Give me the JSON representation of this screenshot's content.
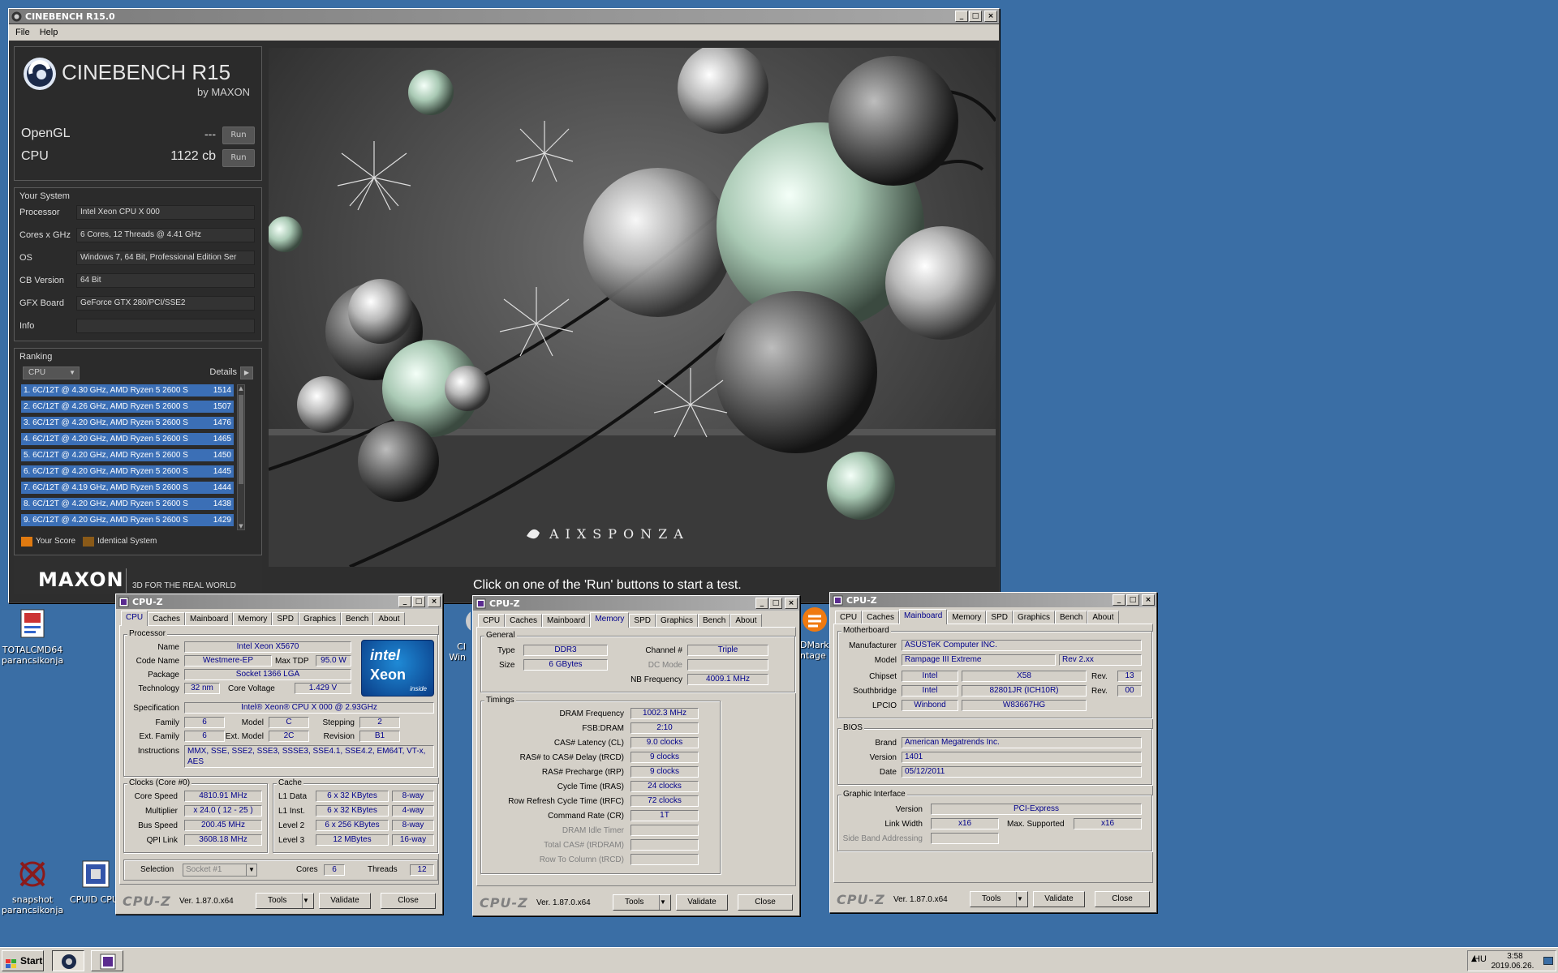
{
  "desktop": {
    "icons": [
      {
        "label": "TOTALCMD64\nparancsikonja"
      },
      {
        "label": "snapshot\nparancsikonja"
      },
      {
        "label": "CPUID CPU-"
      },
      {
        "label": "CI\nWin"
      },
      {
        "label": "DMark\nntage"
      }
    ]
  },
  "cinebench": {
    "title": "CINEBENCH R15.0",
    "menu": [
      "File",
      "Help"
    ],
    "logo_main": "CINEBENCH R15",
    "logo_sub": "by MAXON",
    "tests": [
      {
        "name": "OpenGL",
        "score": "---",
        "button": "Run"
      },
      {
        "name": "CPU",
        "score": "1122 cb",
        "button": "Run"
      }
    ],
    "your_system_title": "Your System",
    "system": [
      {
        "label": "Processor",
        "value": "Intel Xeon CPU X 000"
      },
      {
        "label": "Cores x GHz",
        "value": "6 Cores, 12 Threads @ 4.41 GHz"
      },
      {
        "label": "OS",
        "value": "Windows 7, 64 Bit, Professional Edition Ser"
      },
      {
        "label": "CB Version",
        "value": "64 Bit"
      },
      {
        "label": "GFX Board",
        "value": "GeForce GTX 280/PCI/SSE2"
      },
      {
        "label": "Info",
        "value": ""
      }
    ],
    "ranking_title": "Ranking",
    "ranking_select": "CPU",
    "details_label": "Details",
    "ranking": [
      {
        "text": "1. 6C/12T @ 4.30 GHz, AMD Ryzen 5 2600 S",
        "score": "1514"
      },
      {
        "text": "2. 6C/12T @ 4.26 GHz, AMD Ryzen 5 2600 S",
        "score": "1507"
      },
      {
        "text": "3. 6C/12T @ 4.20 GHz, AMD Ryzen 5 2600 S",
        "score": "1476"
      },
      {
        "text": "4. 6C/12T @ 4.20 GHz, AMD Ryzen 5 2600 S",
        "score": "1465"
      },
      {
        "text": "5. 6C/12T @ 4.20 GHz, AMD Ryzen 5 2600 S",
        "score": "1450"
      },
      {
        "text": "6. 6C/12T @ 4.20 GHz, AMD Ryzen 5 2600 S",
        "score": "1445"
      },
      {
        "text": "7. 6C/12T @ 4.19 GHz, AMD Ryzen 5 2600 S",
        "score": "1444"
      },
      {
        "text": "8. 6C/12T @ 4.20 GHz, AMD Ryzen 5 2600 S",
        "score": "1438"
      },
      {
        "text": "9. 6C/12T @ 4.20 GHz, AMD Ryzen 5 2600 S",
        "score": "1429"
      }
    ],
    "legend_your": "Your Score",
    "legend_identical": "Identical System",
    "maxon": "MAXON",
    "tagline": "3D FOR THE REAL WORLD",
    "render_credit": "AIXSPONZA",
    "status": "Click on one of the 'Run' buttons to start a test."
  },
  "cpuz_cpu": {
    "title": "CPU-Z",
    "tabs": [
      "CPU",
      "Caches",
      "Mainboard",
      "Memory",
      "SPD",
      "Graphics",
      "Bench",
      "About"
    ],
    "processor_group": "Processor",
    "name_label": "Name",
    "name": "Intel Xeon X5670",
    "codename_label": "Code Name",
    "codename": "Westmere-EP",
    "tdp_label": "Max TDP",
    "tdp": "95.0 W",
    "package_label": "Package",
    "package": "Socket 1366 LGA",
    "tech_label": "Technology",
    "tech": "32 nm",
    "voltage_label": "Core Voltage",
    "voltage": "1.429 V",
    "badge_brand": "intel",
    "badge_name": "Xeon",
    "badge_inside": "inside",
    "spec_label": "Specification",
    "spec": "Intel® Xeon® CPU      X 000  @ 2.93GHz",
    "family_label": "Family",
    "family": "6",
    "model_label": "Model",
    "model": "C",
    "stepping_label": "Stepping",
    "stepping": "2",
    "extfamily_label": "Ext. Family",
    "extfamily": "6",
    "extmodel_label": "Ext. Model",
    "extmodel": "2C",
    "revision_label": "Revision",
    "revision": "B1",
    "instr_label": "Instructions",
    "instructions": "MMX, SSE, SSE2, SSE3, SSSE3, SSE4.1, SSE4.2, EM64T, VT-x, AES",
    "clocks_group": "Clocks (Core #0)",
    "corespeed_label": "Core Speed",
    "corespeed": "4810.91 MHz",
    "mult_label": "Multiplier",
    "mult": "x 24.0 ( 12 - 25 )",
    "bus_label": "Bus Speed",
    "bus": "200.45 MHz",
    "qpi_label": "QPI Link",
    "qpi": "3608.18 MHz",
    "cache_group": "Cache",
    "l1d_label": "L1 Data",
    "l1d": "6 x 32 KBytes",
    "l1d_way": "8-way",
    "l1i_label": "L1 Inst.",
    "l1i": "6 x 32 KBytes",
    "l1i_way": "4-way",
    "l2_label": "Level 2",
    "l2": "6 x 256 KBytes",
    "l2_way": "8-way",
    "l3_label": "Level 3",
    "l3": "12 MBytes",
    "l3_way": "16-way",
    "selection_label": "Selection",
    "selection": "Socket #1",
    "cores_label": "Cores",
    "cores": "6",
    "threads_label": "Threads",
    "threads": "12",
    "logo": "CPU-Z",
    "version": "Ver. 1.87.0.x64",
    "tools": "Tools",
    "validate": "Validate",
    "close": "Close"
  },
  "cpuz_mem": {
    "title": "CPU-Z",
    "tabs": [
      "CPU",
      "Caches",
      "Mainboard",
      "Memory",
      "SPD",
      "Graphics",
      "Bench",
      "About"
    ],
    "general_group": "General",
    "type_label": "Type",
    "type": "DDR3",
    "size_label": "Size",
    "size": "6 GBytes",
    "channel_label": "Channel #",
    "channel": "Triple",
    "dcmode_label": "DC Mode",
    "dcmode": "",
    "nbfreq_label": "NB Frequency",
    "nbfreq": "4009.1 MHz",
    "timings_group": "Timings",
    "timings": [
      {
        "label": "DRAM Frequency",
        "value": "1002.3 MHz",
        "dim": false
      },
      {
        "label": "FSB:DRAM",
        "value": "2:10",
        "dim": false
      },
      {
        "label": "CAS# Latency (CL)",
        "value": "9.0 clocks",
        "dim": false
      },
      {
        "label": "RAS# to CAS# Delay (tRCD)",
        "value": "9 clocks",
        "dim": false
      },
      {
        "label": "RAS# Precharge (tRP)",
        "value": "9 clocks",
        "dim": false
      },
      {
        "label": "Cycle Time (tRAS)",
        "value": "24 clocks",
        "dim": false
      },
      {
        "label": "Row Refresh Cycle Time (tRFC)",
        "value": "72 clocks",
        "dim": false
      },
      {
        "label": "Command Rate (CR)",
        "value": "1T",
        "dim": false
      },
      {
        "label": "DRAM Idle Timer",
        "value": "",
        "dim": true
      },
      {
        "label": "Total CAS# (tRDRAM)",
        "value": "",
        "dim": true
      },
      {
        "label": "Row To Column (tRCD)",
        "value": "",
        "dim": true
      }
    ],
    "logo": "CPU-Z",
    "version": "Ver. 1.87.0.x64",
    "tools": "Tools",
    "validate": "Validate",
    "close": "Close"
  },
  "cpuz_mb": {
    "title": "CPU-Z",
    "tabs": [
      "CPU",
      "Caches",
      "Mainboard",
      "Memory",
      "SPD",
      "Graphics",
      "Bench",
      "About"
    ],
    "mb_group": "Motherboard",
    "manufacturer_label": "Manufacturer",
    "manufacturer": "ASUSTeK Computer INC.",
    "model_label": "Model",
    "model": "Rampage III Extreme",
    "model_rev": "Rev 2.xx",
    "chipset_label": "Chipset",
    "chipset_vendor": "Intel",
    "chipset": "X58",
    "chipset_rev_label": "Rev.",
    "chipset_rev": "13",
    "south_label": "Southbridge",
    "south_vendor": "Intel",
    "south": "82801JR (ICH10R)",
    "south_rev_label": "Rev.",
    "south_rev": "00",
    "lpcio_label": "LPCIO",
    "lpcio_vendor": "Winbond",
    "lpcio": "W83667HG",
    "bios_group": "BIOS",
    "brand_label": "Brand",
    "brand": "American Megatrends Inc.",
    "version_label": "Version",
    "bios_version": "1401",
    "date_label": "Date",
    "date": "05/12/2011",
    "gi_group": "Graphic Interface",
    "gi_version_label": "Version",
    "gi_version": "PCI-Express",
    "link_label": "Link Width",
    "link": "x16",
    "max_label": "Max. Supported",
    "max": "x16",
    "sideband_label": "Side Band Addressing",
    "sideband": "",
    "logo": "CPU-Z",
    "version": "Ver. 1.87.0.x64",
    "tools": "Tools",
    "validate": "Validate",
    "close": "Close"
  },
  "taskbar": {
    "start": "Start",
    "lang": "HU",
    "time": "3:58",
    "date": "2019.06.26."
  }
}
